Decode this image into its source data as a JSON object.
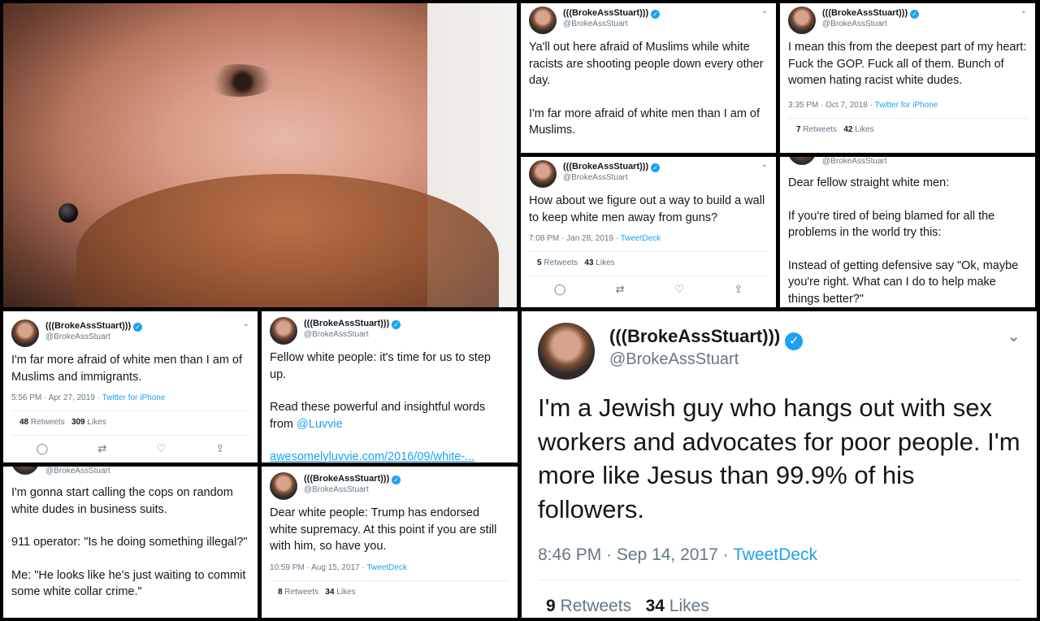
{
  "author": {
    "name": "(((BrokeAssStuart)))",
    "handle": "@BrokeAssStuart",
    "verified_glyph": "✓",
    "menu_glyph": "⌄"
  },
  "actions": {
    "reply": "◯",
    "retweet": "⇄",
    "like": "♡",
    "share": "⇪"
  },
  "tweets": [
    {
      "lines": [
        "Ya'll out here afraid of Muslims while white racists are shooting people down every other day.",
        "I'm far more afraid of white men than I am of Muslims."
      ]
    },
    {
      "lines": [
        "I mean this from the deepest part of my heart: Fuck the GOP. Fuck all of them. Bunch of women hating racist white dudes."
      ],
      "time": "3:35 PM · Oct 7, 2018",
      "source": "Twitter for iPhone",
      "retweets": "7",
      "retweets_label": "Retweets",
      "likes": "42",
      "likes_label": "Likes"
    },
    {
      "lines": [
        "How about we figure out a way to build a wall to keep white men away from guns?"
      ],
      "time": "7:08 PM · Jan 28, 2019",
      "source": "TweetDeck",
      "retweets": "5",
      "retweets_label": "Retweets",
      "likes": "43",
      "likes_label": "Likes"
    },
    {
      "lines": [
        "Dear fellow straight white men:",
        "If you're tired of being blamed for all the problems in the world try this:",
        "Instead of getting defensive say \"Ok, maybe you're right. What can I do to help make things better?\""
      ]
    },
    {
      "lines": [
        "I'm far more afraid of white men than I am of Muslims and immigrants."
      ],
      "time": "5:56 PM · Apr 27, 2019",
      "source": "Twitter for iPhone",
      "retweets": "48",
      "retweets_label": "Retweets",
      "likes": "309",
      "likes_label": "Likes"
    },
    {
      "lines": [
        "Fellow white people: it's time for us to step up.",
        "Read these powerful and insightful words from"
      ],
      "mention": "@Luvvie",
      "url": "awesomelyluvvie.com/2016/09/white-..."
    },
    {
      "lines": [
        "I'm gonna start calling the cops on random white dudes in business suits.",
        "911 operator: \"Is he doing something illegal?\"",
        "Me: \"He looks like he's just waiting to commit some white collar crime.\""
      ]
    },
    {
      "lines": [
        "Dear white people: Trump has endorsed white supremacy. At this point if you are still with him, so have you."
      ],
      "time": "10:59 PM · Aug 15, 2017",
      "source": "TweetDeck",
      "retweets": "8",
      "retweets_label": "Retweets",
      "likes": "34",
      "likes_label": "Likes"
    },
    {
      "lines": [
        "I'm a Jewish guy who hangs out with sex workers and advocates for poor people. I'm more like Jesus than 99.9% of his followers."
      ],
      "time": "8:46 PM · Sep 14, 2017",
      "source": "TweetDeck",
      "retweets": "9",
      "retweets_label": "Retweets",
      "likes": "34",
      "likes_label": "Likes"
    }
  ]
}
